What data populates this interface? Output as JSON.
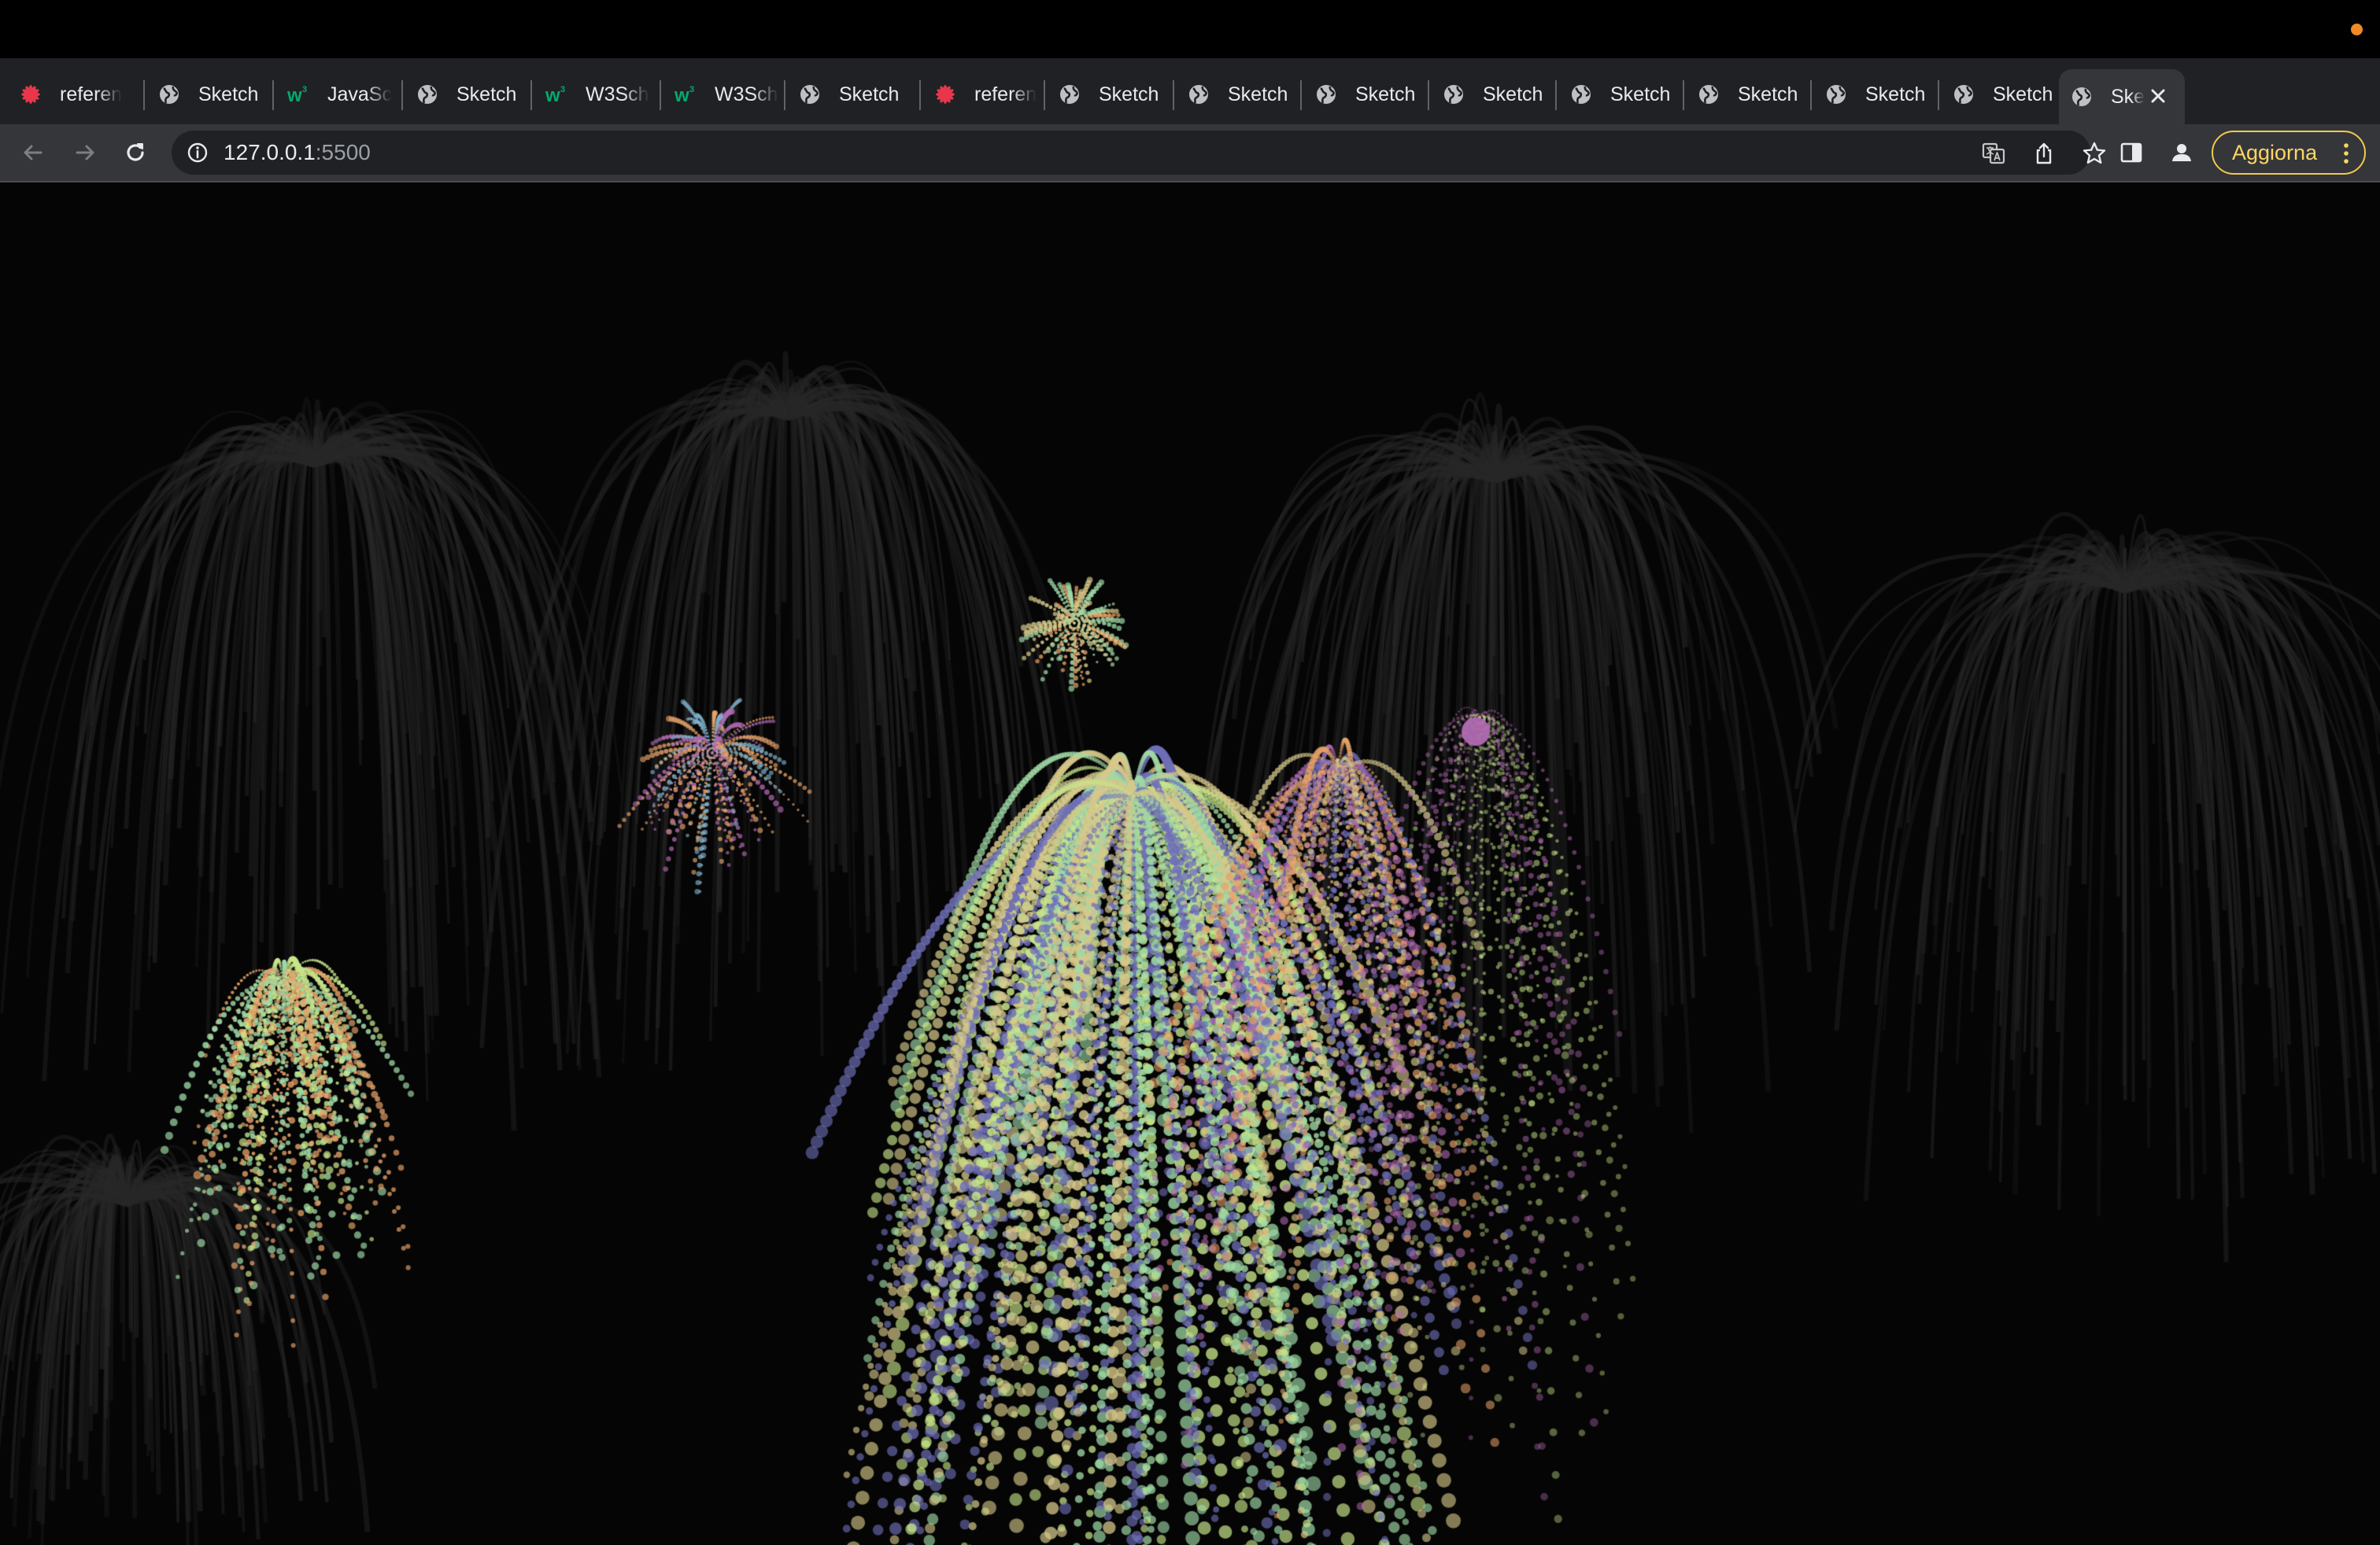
{
  "browser": {
    "tabs": [
      {
        "label": "referen",
        "favicon": "asterisk-icon",
        "color": "#e8374a",
        "fade": true,
        "active": false
      },
      {
        "label": "Sketch",
        "favicon": "globe-icon",
        "fade": false,
        "active": false
      },
      {
        "label": "JavaSc",
        "favicon": "w3schools-icon",
        "color": "#04aa6d",
        "fade": true,
        "active": false
      },
      {
        "label": "Sketch",
        "favicon": "globe-icon",
        "fade": false,
        "active": false
      },
      {
        "label": "W3Sch",
        "favicon": "w3schools-icon",
        "color": "#04aa6d",
        "fade": true,
        "active": false
      },
      {
        "label": "W3Sch",
        "favicon": "w3schools-icon",
        "color": "#04aa6d",
        "fade": true,
        "active": false
      },
      {
        "label": "Sketch",
        "favicon": "globe-icon",
        "fade": false,
        "active": false
      },
      {
        "label": "referen",
        "favicon": "asterisk-icon",
        "color": "#e8374a",
        "fade": true,
        "active": false
      },
      {
        "label": "Sketch",
        "favicon": "globe-icon",
        "fade": false,
        "active": false
      },
      {
        "label": "Sketch",
        "favicon": "globe-icon",
        "fade": false,
        "active": false
      },
      {
        "label": "Sketch",
        "favicon": "globe-icon",
        "fade": false,
        "active": false
      },
      {
        "label": "Sketch",
        "favicon": "globe-icon",
        "fade": false,
        "active": false
      },
      {
        "label": "Sketch",
        "favicon": "globe-icon",
        "fade": false,
        "active": false
      },
      {
        "label": "Sketch",
        "favicon": "globe-icon",
        "fade": false,
        "active": false
      },
      {
        "label": "Sketch",
        "favicon": "globe-icon",
        "fade": false,
        "active": false
      },
      {
        "label": "Sketch",
        "favicon": "globe-icon",
        "fade": false,
        "active": false
      },
      {
        "label": "Ske",
        "favicon": "globe-icon",
        "fade": true,
        "active": true
      }
    ],
    "address": {
      "host": "127.0.0.1",
      "port": ":5500"
    },
    "update_button": "Aggiorna",
    "colors": {
      "titlebar": "#000000",
      "tabstrip": "#202124",
      "toolbar": "#35363a",
      "omnibox": "#202124",
      "text": "#e8eaed",
      "update_accent": "#fdd663",
      "notification_dot": "#f08a24"
    },
    "icons": {
      "back": "arrow-left-icon",
      "forward": "arrow-right-icon",
      "reload": "reload-icon",
      "site_info": "info-icon",
      "translate": "translate-icon",
      "share": "share-icon",
      "bookmark": "star-icon",
      "side_panel": "side-panel-icon",
      "profile": "profile-icon",
      "menu": "kebab-menu-icon",
      "new_tab": "plus-icon",
      "tab_search": "chevron-down-icon",
      "close_tab": "close-icon"
    }
  },
  "page": {
    "background": "#050505",
    "content": "fireworks-canvas",
    "palette": [
      "#c8e68a",
      "#9fd9a6",
      "#6f6fb8",
      "#e8a36a",
      "#b06ab0",
      "#d7c98a",
      "#7fb0c9"
    ]
  }
}
